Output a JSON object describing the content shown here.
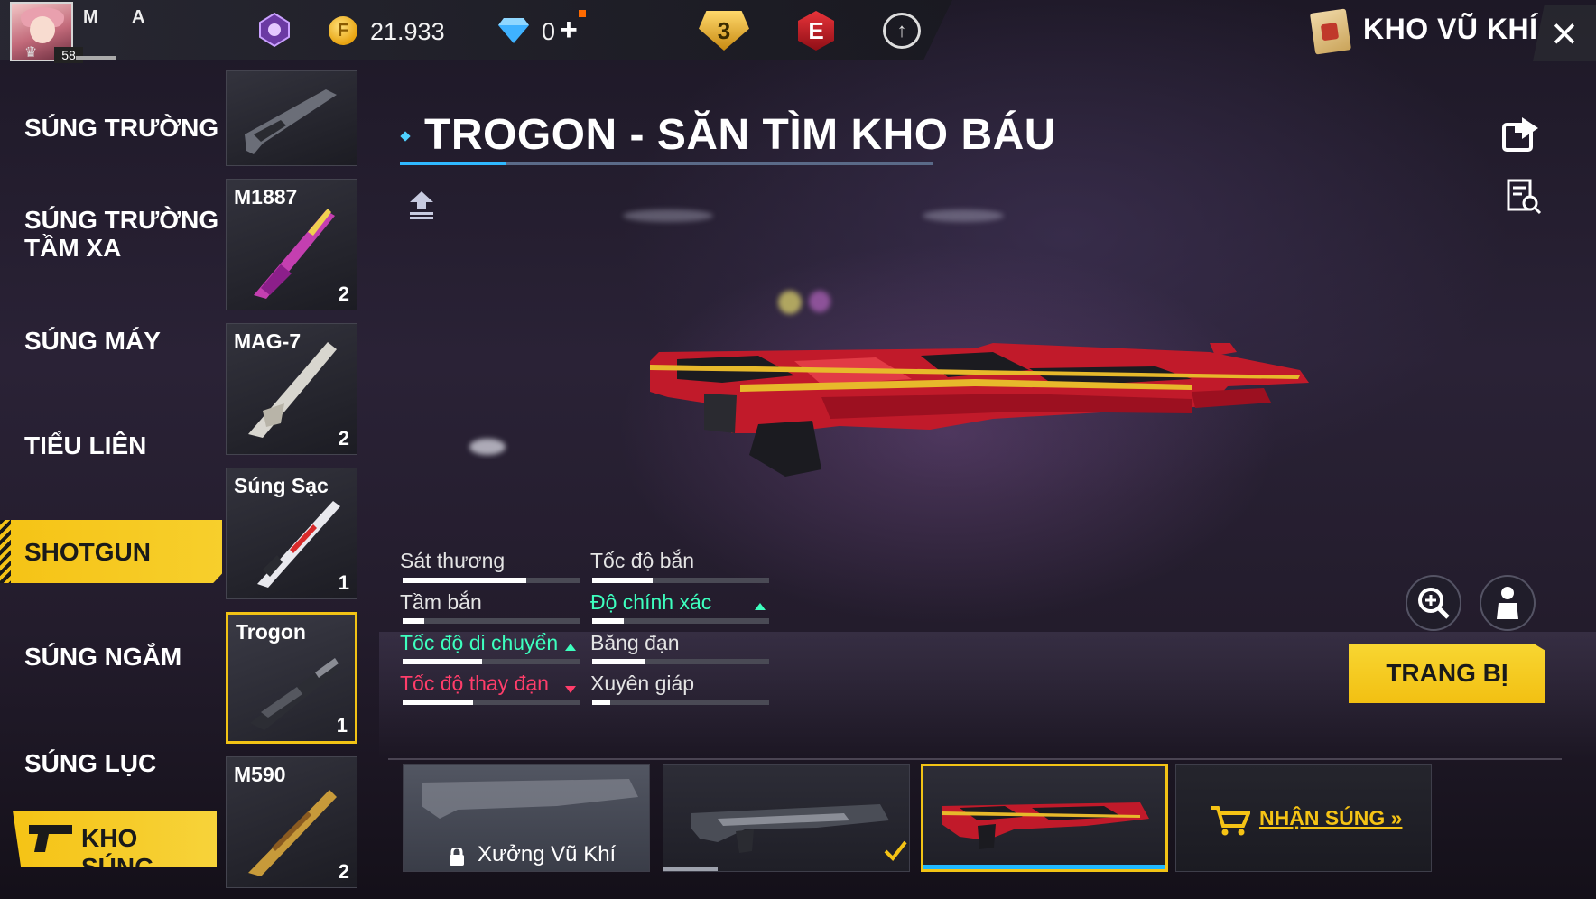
{
  "player": {
    "name_left": "M",
    "name_right": "A",
    "level": "58"
  },
  "currency": {
    "gold": "21.933",
    "diamonds": "0",
    "diamond_add": "+"
  },
  "header": {
    "rank_badge": "3",
    "elite_badge": "E",
    "title": "KHO VŨ KHÍ",
    "icons": [
      "clan-badge-icon",
      "gold-coin-icon",
      "diamond-icon",
      "rank-icon",
      "elite-pass-icon",
      "cloud-upload-icon",
      "weapon-vault-icon",
      "close-icon"
    ]
  },
  "categories": {
    "items": [
      {
        "label": "SÚNG TRƯỜNG"
      },
      {
        "label_line1": "SÚNG TRƯỜNG",
        "label_line2": "TẦM XA"
      },
      {
        "label": "SÚNG MÁY"
      },
      {
        "label": "TIỂU LIÊN"
      },
      {
        "label": "SHOTGUN",
        "active": true
      },
      {
        "label": "SÚNG NGẮM"
      },
      {
        "label": "SÚNG LỤC"
      }
    ],
    "vault_button": "KHO SÚNG"
  },
  "weapons": [
    {
      "name": "",
      "count": ""
    },
    {
      "name": "M1887",
      "count": "2"
    },
    {
      "name": "MAG-7",
      "count": "2"
    },
    {
      "name": "Súng Sạc",
      "count": "1"
    },
    {
      "name": "Trogon",
      "count": "1",
      "selected": true
    },
    {
      "name": "M590",
      "count": "2"
    }
  ],
  "weapon_detail": {
    "title": "TROGON - SĂN TÌM KHO BÁU",
    "stats": [
      {
        "label": "Sát thương",
        "value": 0.7,
        "trend": "none"
      },
      {
        "label": "Tốc độ bắn",
        "value": 0.34,
        "trend": "none"
      },
      {
        "label": "Tầm bắn",
        "value": 0.12,
        "trend": "none"
      },
      {
        "label": "Độ chính xác",
        "value": 0.18,
        "trend": "up"
      },
      {
        "label": "Tốc độ di chuyển",
        "value": 0.45,
        "trend": "up"
      },
      {
        "label": "Băng đạn",
        "value": 0.3,
        "trend": "none"
      },
      {
        "label": "Tốc độ thay đạn",
        "value": 0.4,
        "trend": "down"
      },
      {
        "label": "Xuyên giáp",
        "value": 0.1,
        "trend": "none"
      }
    ],
    "equip_label": "TRANG BỊ"
  },
  "skins": {
    "locked_label": "Xưởng Vũ Khí",
    "get_gun_label": "NHẬN SÚNG »"
  },
  "colors": {
    "accent_yellow": "#f5c315",
    "accent_blue": "#1fb8ff",
    "stat_up": "#3dffbe",
    "stat_down": "#ff3d6a"
  }
}
